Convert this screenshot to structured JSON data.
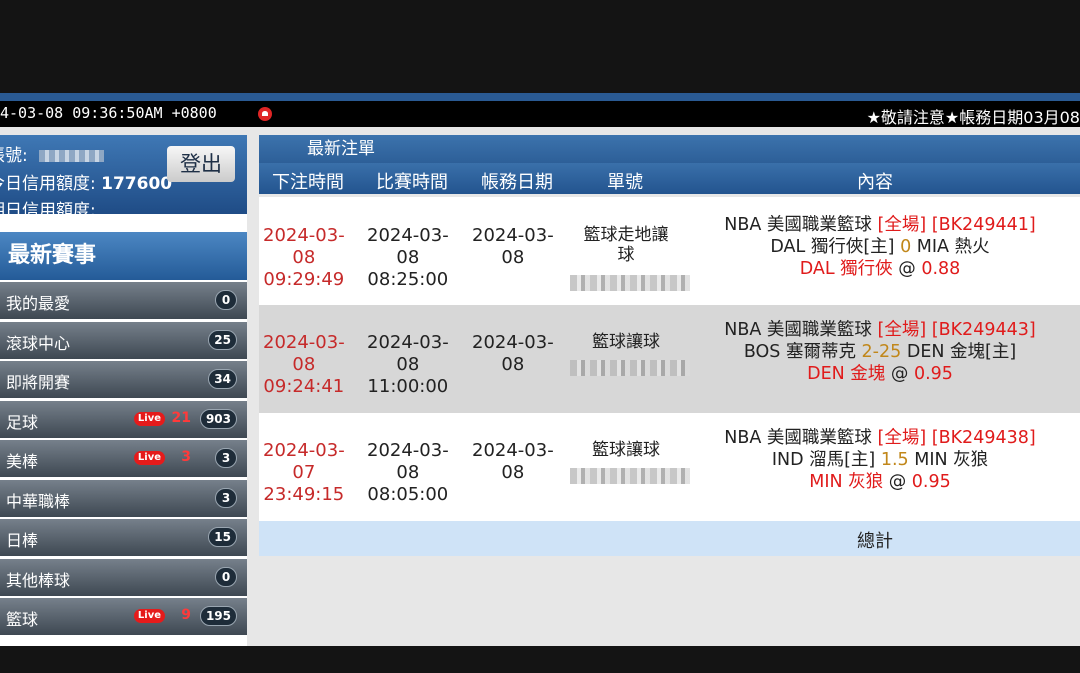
{
  "header": {
    "clock": "4-03-08 09:36:50AM +0800",
    "notice": "★敬請注意★帳務日期03月08"
  },
  "account": {
    "account_label": "帳號:",
    "credit_label": "今日信用額度:",
    "credit_value": "177600",
    "other_label": "明日信用額度:",
    "logout_label": "登出"
  },
  "sidebar": {
    "events_title": "最新賽事",
    "items": [
      {
        "label": "我的最愛",
        "live": "",
        "live_count": "",
        "count": "0"
      },
      {
        "label": "滾球中心",
        "live": "",
        "live_count": "",
        "count": "25"
      },
      {
        "label": "即將開賽",
        "live": "",
        "live_count": "",
        "count": "34"
      },
      {
        "label": "足球",
        "live": "Live",
        "live_count": "21",
        "count": "903"
      },
      {
        "label": "美棒",
        "live": "Live",
        "live_count": "3",
        "count": "3"
      },
      {
        "label": "中華職棒",
        "live": "",
        "live_count": "",
        "count": "3"
      },
      {
        "label": "日棒",
        "live": "",
        "live_count": "",
        "count": "15"
      },
      {
        "label": "其他棒球",
        "live": "",
        "live_count": "",
        "count": "0"
      },
      {
        "label": "籃球",
        "live": "Live",
        "live_count": "9",
        "count": "195"
      }
    ]
  },
  "main": {
    "title": "最新注單",
    "columns": [
      "下注時間",
      "比賽時間",
      "帳務日期",
      "單號",
      "內容"
    ],
    "total_label": "總計",
    "rows": [
      {
        "bet_date": "2024-03-",
        "bet_date2": "08",
        "bet_time": "09:29:49",
        "match_date": "2024-03-",
        "match_date2": "08",
        "match_time": "08:25:00",
        "settle_date": "2024-03-",
        "settle_date2": "08",
        "type": "籃球走地讓",
        "type2": "球",
        "league": "NBA 美國職業籃球",
        "period": "[全場]",
        "code": "[BK249441]",
        "team_home": "DAL 獨行俠[主]",
        "handicap": "0",
        "team_away": "MIA 熱火",
        "pick": "DAL 獨行俠",
        "at": "@",
        "odds": "0.88"
      },
      {
        "bet_date": "2024-03-",
        "bet_date2": "08",
        "bet_time": "09:24:41",
        "match_date": "2024-03-",
        "match_date2": "08",
        "match_time": "11:00:00",
        "settle_date": "2024-03-",
        "settle_date2": "08",
        "type": "籃球讓球",
        "type2": "",
        "league": "NBA 美國職業籃球",
        "period": "[全場]",
        "code": "[BK249443]",
        "team_home": "BOS 塞爾蒂克",
        "handicap": "2-25",
        "team_away": "DEN 金塊[主]",
        "pick": "DEN 金塊",
        "at": "@",
        "odds": "0.95"
      },
      {
        "bet_date": "2024-03-",
        "bet_date2": "07",
        "bet_time": "23:49:15",
        "match_date": "2024-03-",
        "match_date2": "08",
        "match_time": "08:05:00",
        "settle_date": "2024-03-",
        "settle_date2": "08",
        "type": "籃球讓球",
        "type2": "",
        "league": "NBA 美國職業籃球",
        "period": "[全場]",
        "code": "[BK249438]",
        "team_home": "IND 溜馬[主]",
        "handicap": "1.5",
        "team_away": "MIN 灰狼",
        "pick": "MIN 灰狼",
        "at": "@",
        "odds": "0.95"
      }
    ]
  }
}
